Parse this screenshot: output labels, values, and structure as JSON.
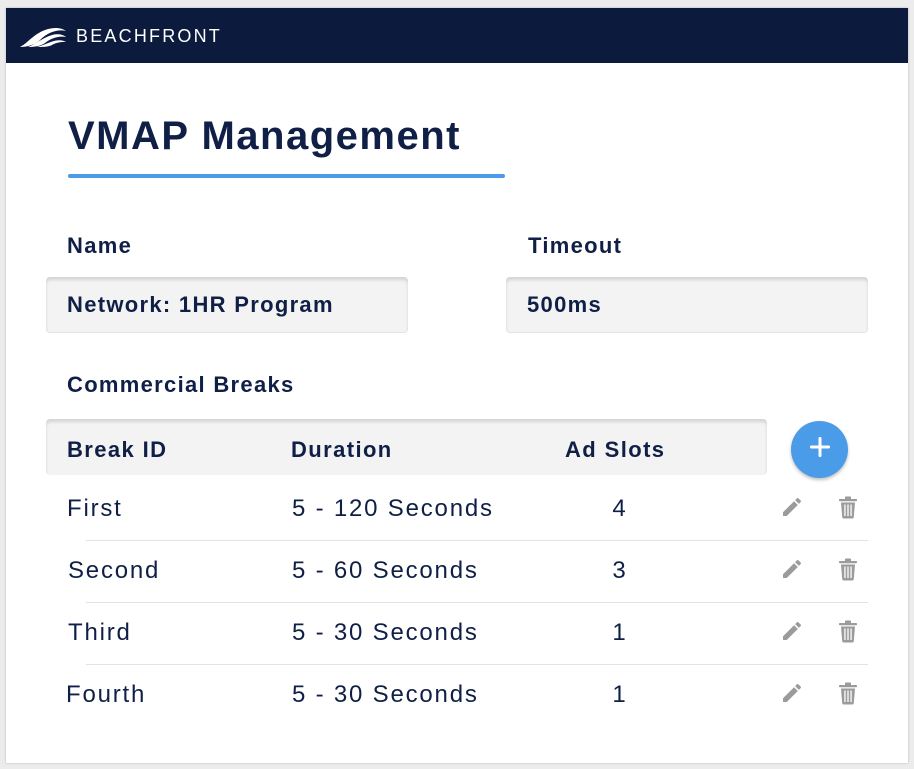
{
  "header": {
    "brand": "BEACHFRONT",
    "logo_icon": "beachfront-wave-logo-icon",
    "background_color": "#0b1a3d"
  },
  "page": {
    "title": "VMAP Management",
    "accent_color": "#4a9be8"
  },
  "form": {
    "name": {
      "label": "Name",
      "value": "Network: 1HR Program"
    },
    "timeout": {
      "label": "Timeout",
      "value": "500ms"
    }
  },
  "breaks": {
    "section_label": "Commercial Breaks",
    "columns": {
      "break_id": "Break ID",
      "duration": "Duration",
      "ad_slots": "Ad Slots"
    },
    "add_icon": "plus-icon",
    "edit_icon": "pencil-icon",
    "delete_icon": "trash-icon",
    "rows": [
      {
        "break_id": "First",
        "duration": "5 - 120 Seconds",
        "ad_slots": "4"
      },
      {
        "break_id": "Second",
        "duration": "5 - 60 Seconds",
        "ad_slots": "3"
      },
      {
        "break_id": "Third",
        "duration": "5 - 30 Seconds",
        "ad_slots": "1"
      },
      {
        "break_id": "Fourth",
        "duration": "5 - 30 Seconds",
        "ad_slots": "1"
      }
    ]
  }
}
